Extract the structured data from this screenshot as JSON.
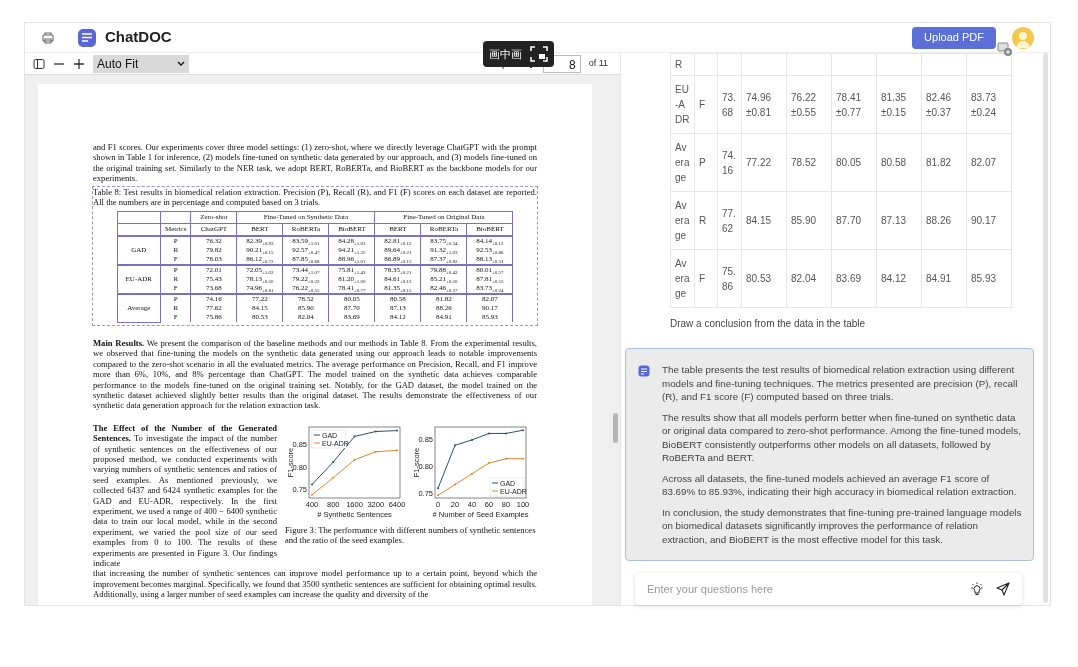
{
  "header": {
    "app_name": "ChatDOC",
    "upload_button": "Upload PDF"
  },
  "pip_tooltip": {
    "label": "画中画"
  },
  "pdf_toolbar": {
    "zoom_select": "Auto Fit",
    "page": "8",
    "page_total": "of 11"
  },
  "pdf_page": {
    "intro": "and F1 scores. Our experiments cover three model settings: (1) zero-shot, where we directly leverage ChatGPT with the prompt shown in Table 1 for inference, (2) models fine-tuned on synthetic data generated by our approach, and (3) models fine-tuned on the original training set. Similarly to the NER task, we adopt BERT, RoBERTa, and BioBERT as the backbone models for our experiments.",
    "table_caption": "Table 8: Test results in biomedical relation extraction. Precision (P), Recall (R), and F1 (F) scores on each dataset are reported. All the numbers are in percentage and computed based on 3 trials.",
    "table": {
      "metrics_header": "Metrics",
      "column_groups": [
        {
          "label": "Zero-shot",
          "columns": [
            "ChatGPT"
          ]
        },
        {
          "label": "Fine-Tuned on Synthetic Data",
          "columns": [
            "BERT",
            "RoBERTa",
            "BioBERT"
          ]
        },
        {
          "label": "Fine-Tuned on Original Data",
          "columns": [
            "BERT",
            "RoBERTa",
            "BioBERT"
          ]
        }
      ],
      "groups": [
        {
          "dataset": "GAD",
          "rows": [
            {
              "metric": "P",
              "values": [
                "76.32",
                "82.39$_{±0.93}$",
                "83.59$_{±1.01}$",
                "84.28$_{±1.03}$",
                "82.81$_{±0.12}$",
                "83.75$_{±0.34}$",
                "84.14$_{±0.12}$"
              ]
            },
            {
              "metric": "R",
              "values": [
                "79.82",
                "90.21$_{±0.15}$",
                "92.57$_{±0.47}$",
                "94.21$_{±1.35}$",
                "89.64$_{±0.21}$",
                "91.32$_{±1.03}$",
                "92.53$_{±0.86}$"
              ]
            },
            {
              "metric": "F",
              "values": [
                "78.03",
                "86.12$_{±0.72}$",
                "87.85$_{±0.68}$",
                "88.96$_{±1.01}$",
                "86.89$_{±0.15}$",
                "87.37$_{±0.82}$",
                "88.13$_{±0.31}$"
              ]
            }
          ]
        },
        {
          "dataset": "EU-ADR",
          "rows": [
            {
              "metric": "P",
              "values": [
                "72.01",
                "72.05$_{±1.02}$",
                "73.44$_{±1.07}$",
                "75.81$_{±1.43}$",
                "78.35$_{±0.21}$",
                "79.88$_{±0.43}$",
                "80.01$_{±0.57}$"
              ]
            },
            {
              "metric": "R",
              "values": [
                "75.43",
                "78.13$_{±0.50}$",
                "79.22$_{±0.22}$",
                "81.20$_{±1.00}$",
                "84.61$_{±0.13}$",
                "85.21$_{±0.20}$",
                "87.81$_{±0.53}$"
              ]
            },
            {
              "metric": "F",
              "values": [
                "73.68",
                "74.96$_{±0.81}$",
                "76.22$_{±0.55}$",
                "78.41$_{±0.77}$",
                "81.35$_{±0.15}$",
                "82.46$_{±0.37}$",
                "83.73$_{±0.24}$"
              ]
            }
          ]
        },
        {
          "dataset": "Average",
          "rows": [
            {
              "metric": "P",
              "values": [
                "74.16",
                "77.22",
                "78.52",
                "80.05",
                "80.58",
                "81.82",
                "82.07"
              ]
            },
            {
              "metric": "R",
              "values": [
                "77.62",
                "84.15",
                "85.90",
                "87.70",
                "87.13",
                "88.26",
                "90.17"
              ]
            },
            {
              "metric": "F",
              "values": [
                "75.86",
                "80.53",
                "82.04",
                "83.69",
                "84.12",
                "84.91",
                "85.93"
              ]
            }
          ]
        }
      ]
    },
    "main_results": "**Main Results.** We present the comparison of the baseline methods and our methods in Table 8. From the experimental results, we observed that fine-tuning the models on the synthetic data generated using our approach leads to notable improvements compared to the zero-shot scenario in all the evaluated metrics. The average performance on Precision, Recall, and F1 improve more than 6%, 10%, and 8% percentage than ChatGPT. The model trained on the synthetic data achieves comparable performance to the models fine-tuned on the original training set. Notably, for the GAD dataset, the model trained on the synthetic dataset achieved slightly better results than the original dataset. The results demonstrate the effectiveness of our synthetic data generation approach for the relation extraction task.",
    "effect_column": "**The Effect of the Number of the Generated Sentences.** To investigate the impact of the number of synthetic sentences on the effectiveness of our proposed method, we conducted experiments with varying numbers of synthetic sentences and ratios of seed examples. As mentioned previously, we collected 6437 and 6424 synthetic examples for the GAD and EU-ADR, respectively. In the first experiment, we used a range of 400 − 6400 synthetic data to train our local model, while in the second experiment, we varied the pool size of our seed examples from 0 to 100. The results of these experiments are presented in Figure 3. Our findings indicate",
    "effect_continued": "that increasing the number of synthetic sentences can improve model performance up to a certain point, beyond which the improvement becomes marginal. Specifically, we found that 3500 synthetic sentences are sufficient for obtaining optimal results. Additionally, using a larger number of seed examples can increase the quality and diversity of the",
    "figure": {
      "caption": "Figure 3: The performance with different numbers of synthetic sentences and the ratio of the seed examples.",
      "panels": [
        {
          "chart_data": {
            "type": "line",
            "legend": true,
            "xlabel": "# Synthetic Sentences",
            "ylabel": "F1-score",
            "categories": [
              "400",
              "800",
              "1600",
              "3200",
              "6400"
            ],
            "series": [
              {
                "name": "GAD",
                "color": "#2b4f73",
                "values": [
                  0.76,
                  0.81,
                  0.867,
                  0.878,
                  0.88
                ]
              },
              {
                "name": "EU-ADR",
                "color": "#d9882c",
                "values": [
                  0.737,
                  0.775,
                  0.815,
                  0.833,
                  0.836
                ]
              }
            ],
            "ylim": [
              0.73,
              0.888
            ],
            "yticks": [
              {
                "value": 0.75,
                "label": "0.75"
              },
              {
                "value": 0.8,
                "label": "0.80"
              },
              {
                "value": 0.85,
                "label": "0.85"
              }
            ]
          }
        },
        {
          "chart_data": {
            "type": "line",
            "legend": true,
            "xlabel": "# Number of Seed Examples",
            "ylabel": "F1-score",
            "categories": [
              "0",
              "20",
              "40",
              "60",
              "80",
              "100"
            ],
            "series": [
              {
                "name": "GAD",
                "color": "#2b4f73",
                "values": [
                  0.758,
                  0.838,
                  0.848,
                  0.86,
                  0.86,
                  0.866
                ]
              },
              {
                "name": "EU-ADR",
                "color": "#d9882c",
                "values": [
                  0.745,
                  0.765,
                  0.785,
                  0.805,
                  0.813,
                  0.813
                ]
              }
            ],
            "ylim": [
              0.74,
              0.872
            ],
            "yticks": [
              {
                "value": 0.75,
                "label": "0.75"
              },
              {
                "value": 0.8,
                "label": "0.80"
              },
              {
                "value": 0.85,
                "label": "0.85"
              }
            ]
          }
        }
      ]
    }
  },
  "chat_table": {
    "rows": [
      {
        "cells": [
          "R"
        ]
      },
      {
        "cells": [
          "EU-ADR",
          "F",
          "73.68",
          "74.96±0.81",
          "76.22±0.55",
          "78.41±0.77",
          "81.35±0.15",
          "82.46±0.37",
          "83.73±0.24"
        ]
      },
      {
        "cells": [
          "Average",
          "P",
          "74.16",
          "77.22",
          "78.52",
          "80.05",
          "80.58",
          "81.82",
          "82.07"
        ]
      },
      {
        "cells": [
          "Average",
          "R",
          "77.62",
          "84.15",
          "85.90",
          "87.70",
          "87.13",
          "88.26",
          "90.17"
        ]
      },
      {
        "cells": [
          "Average",
          "F",
          "75.86",
          "80.53",
          "82.04",
          "83.69",
          "84.12",
          "84.91",
          "85.93"
        ]
      }
    ]
  },
  "user_message": "Draw a conclusion from the data in the table",
  "answer": {
    "paragraphs": [
      "The table presents the test results of biomedical relation extraction using different models and fine-tuning techniques. The metrics presented are precision (P), recall (R), and F1 score (F) computed based on three trials.",
      "The results show that all models perform better when fine-tuned on synthetic data or original data compared to zero-shot performance. Among the fine-tuned models, BioBERT consistently outperforms other models on all datasets, followed by RoBERTa and BERT.",
      "Across all datasets, the fine-tuned models achieved an average F1 score of 83.69% to 85.93%, indicating their high accuracy in biomedical relation extraction.",
      "In conclusion, the study demonstrates that fine-tuning pre-trained language models on biomedical datasets significantly improves the performance of relation extraction, and BioBERT is the most effective model for this task."
    ]
  },
  "chat_input": {
    "placeholder": "Enter your questions here"
  }
}
